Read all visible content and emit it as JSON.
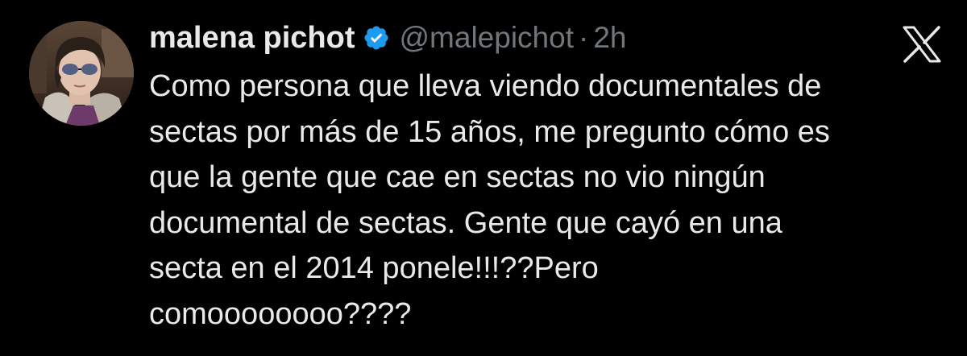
{
  "tweet": {
    "author": {
      "display_name": "malena pichot",
      "handle": "@malepichot",
      "verified": true,
      "verified_color": "#1d9bf0"
    },
    "separator": "·",
    "time": "2h",
    "text_lines": [
      "Como persona que lleva viendo documentales de",
      "sectas por más de 15 años, me pregunto cómo es",
      "que la gente que cae en sectas no vio ningún",
      "documental de sectas. Gente que cayó en una",
      "secta en el 2014 ponele!!!??Pero",
      "comoooooooo????"
    ]
  },
  "icons": {
    "verified": "verified-badge-icon",
    "platform": "x-logo-icon"
  },
  "colors": {
    "background": "#000000",
    "text_primary": "#e7e9ea",
    "text_secondary": "#71767b",
    "accent": "#1d9bf0"
  }
}
